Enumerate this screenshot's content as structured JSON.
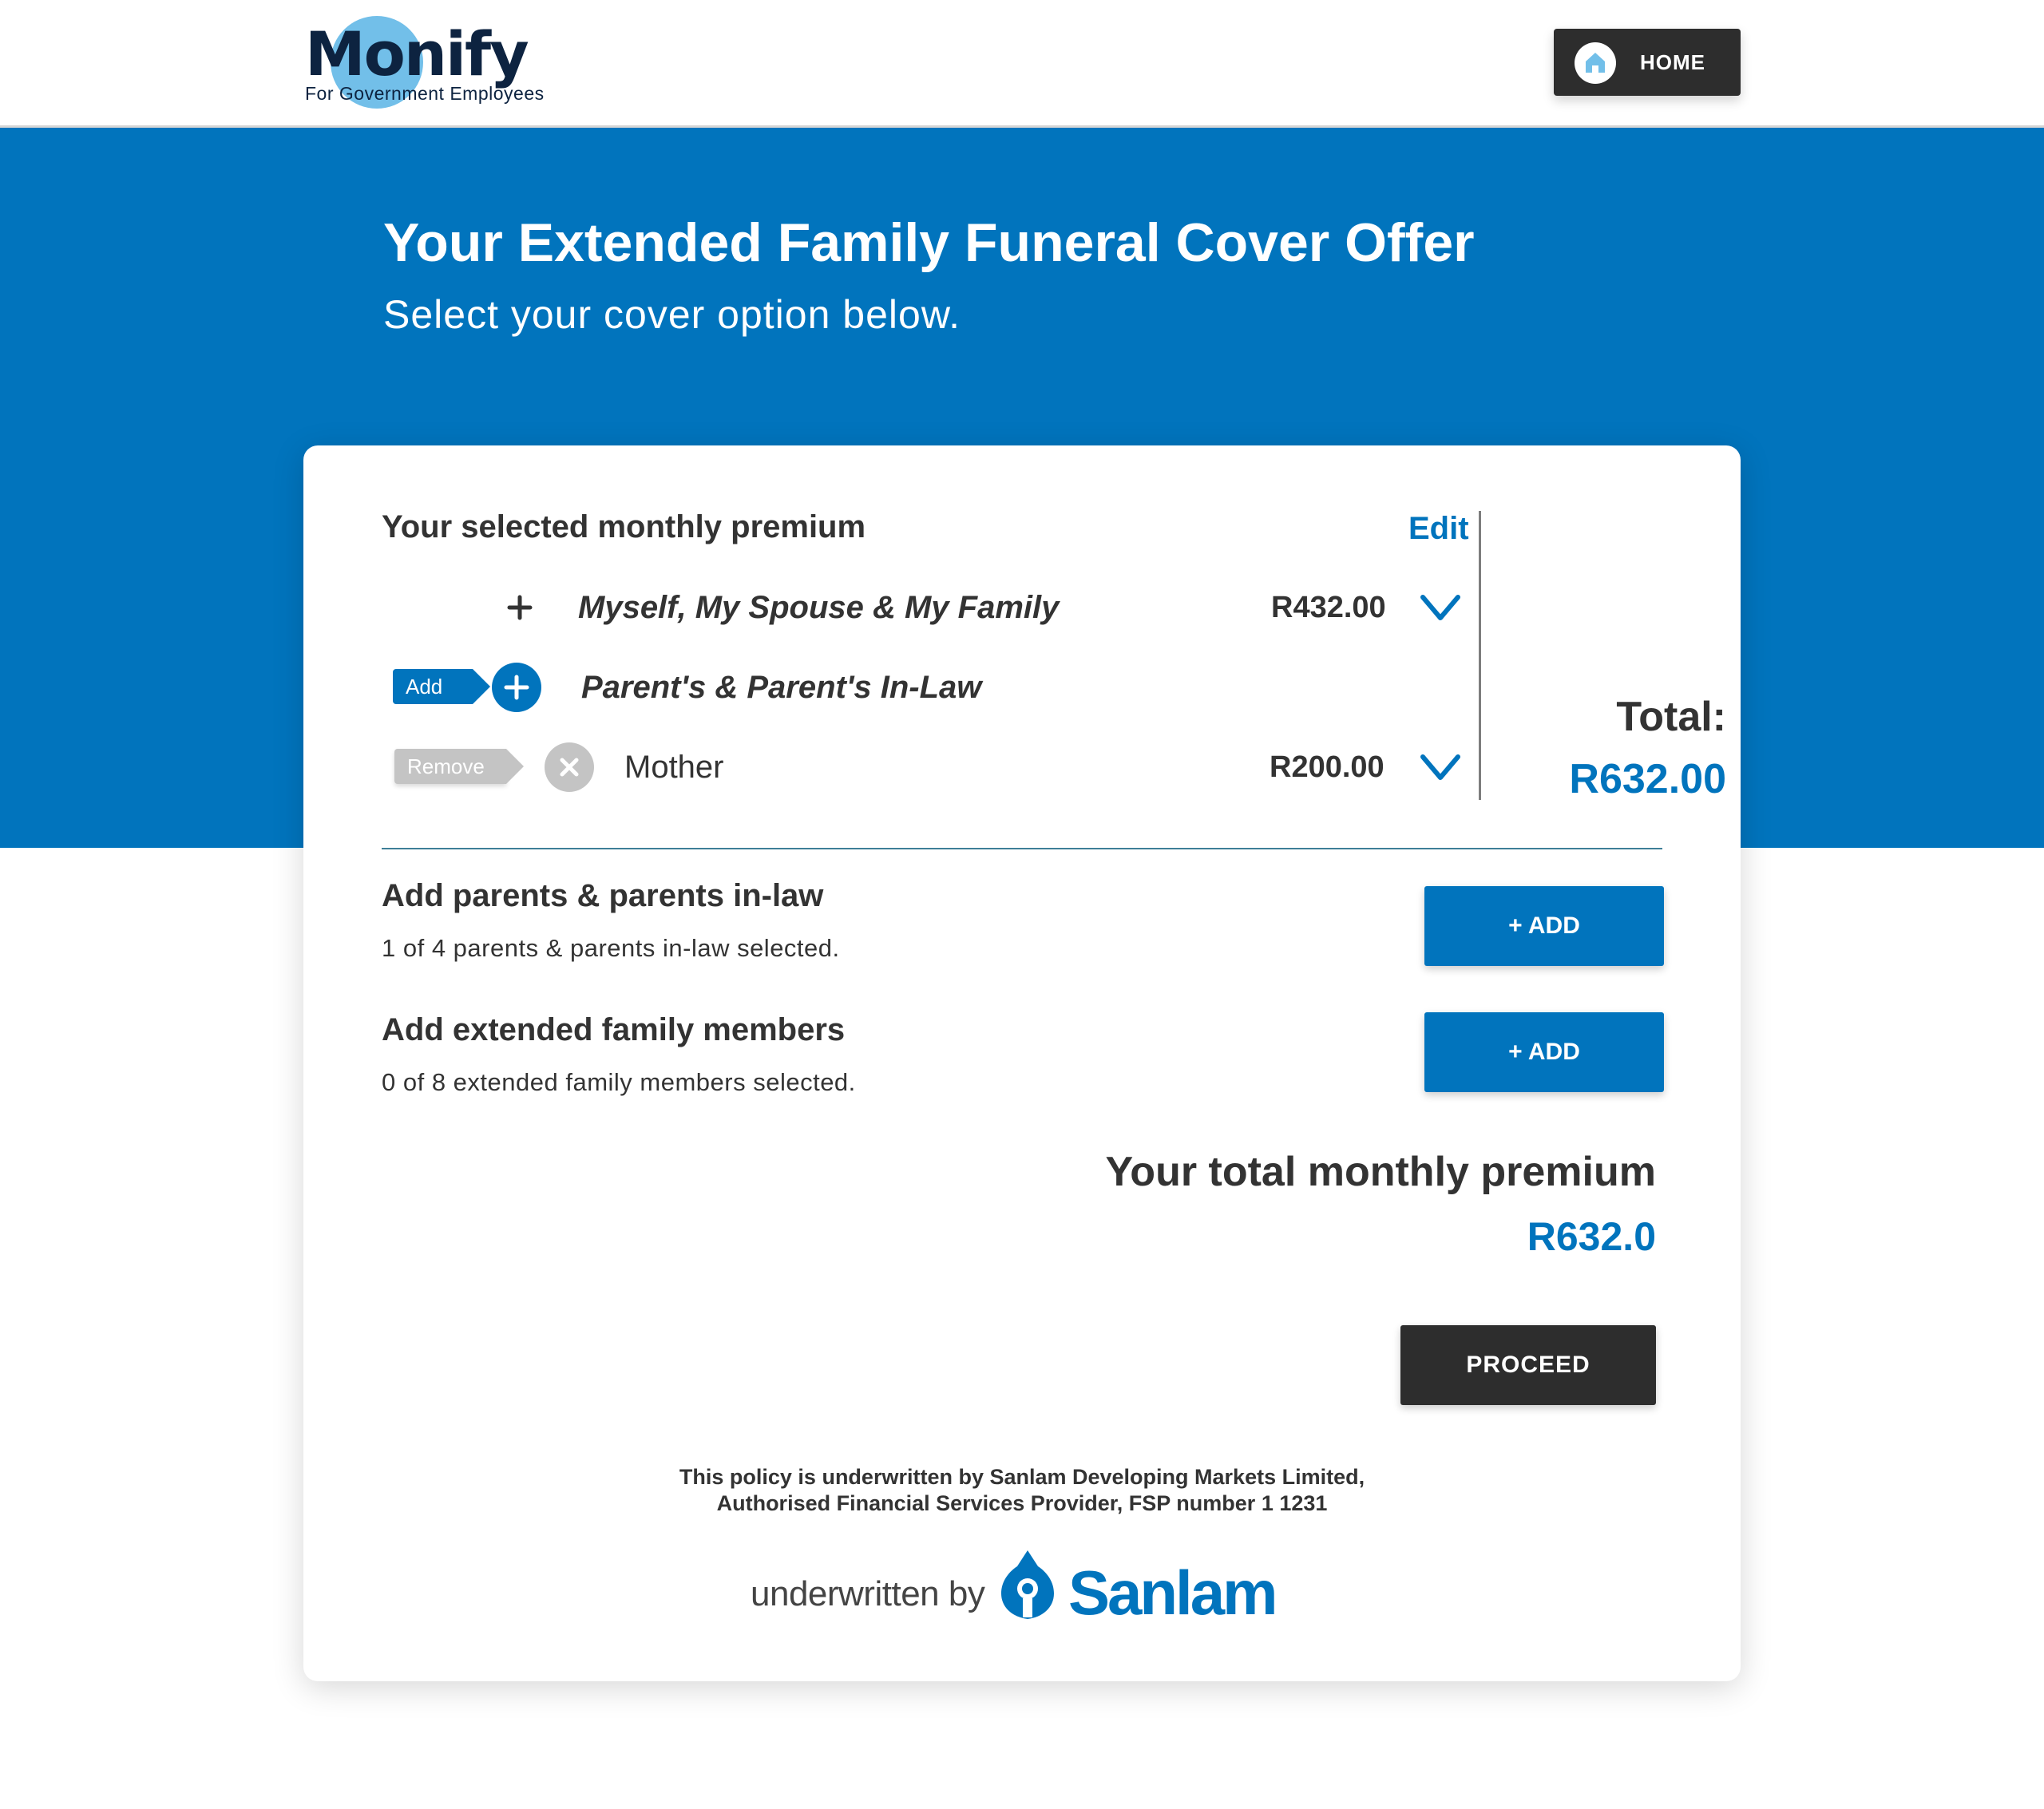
{
  "header": {
    "logo_word": "Monify",
    "logo_tagline": "For Government Employees",
    "home_label": "HOME"
  },
  "hero": {
    "title": "Your Extended Family Funeral Cover Offer",
    "subtitle": "Select your cover option below."
  },
  "premium": {
    "title": "Your selected monthly premium",
    "edit_label": "Edit",
    "rows": [
      {
        "label": "Myself, My Spouse & My Family",
        "price": "R432.00",
        "icon": "plus-icon",
        "action": "chevron-down-icon"
      },
      {
        "tag": "Add",
        "label": "Parent's & Parent's In-Law",
        "icon": "plus-circle-icon"
      },
      {
        "tag": "Remove",
        "label": "Mother",
        "price": "R200.00",
        "icon": "close-circle-icon",
        "action": "chevron-down-icon"
      }
    ],
    "total_label": "Total:",
    "total_amount": "R632.00"
  },
  "sections": [
    {
      "title": "Add parents & parents in-law",
      "desc": "1 of 4 parents & parents in-law selected.",
      "button": "+ ADD"
    },
    {
      "title": "Add extended family members",
      "desc": "0 of 8 extended family members selected.",
      "button": "+ ADD"
    }
  ],
  "grand_total": {
    "label": "Your total monthly premium",
    "amount": "R632.0"
  },
  "proceed_label": "PROCEED",
  "disclaimer": {
    "line1": "This policy is underwritten by Sanlam Developing Markets Limited,",
    "line2": "Authorised Financial Services Provider, FSP number 1 1231"
  },
  "underwriter": {
    "prefix": "underwritten by",
    "brand": "Sanlam"
  },
  "colors": {
    "brand_blue": "#0174bd",
    "dark": "#2d2d2d",
    "logo_circle": "#72bfe9"
  }
}
